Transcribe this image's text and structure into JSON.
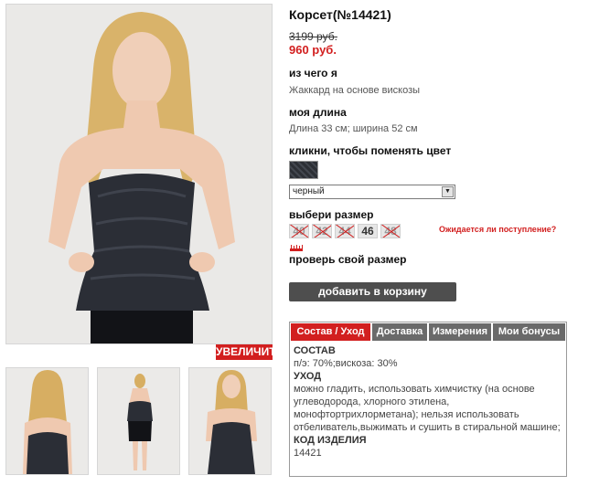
{
  "product": {
    "title": "Корсет(№14421)",
    "old_price": "3199 руб.",
    "new_price": "960 руб."
  },
  "material": {
    "label": "из чего я",
    "value": "Жаккард на основе вискозы"
  },
  "length": {
    "label": "моя длина",
    "value": "Длина 33 см; ширина 52 см"
  },
  "color": {
    "label": "кликни, чтобы поменять цвет",
    "selected": "черный"
  },
  "sizes": {
    "label": "выбери размер",
    "items": [
      {
        "label": "40",
        "available": false
      },
      {
        "label": "42",
        "available": false
      },
      {
        "label": "44",
        "available": false
      },
      {
        "label": "46",
        "available": true
      },
      {
        "label": "48",
        "available": false
      }
    ],
    "notify": "Ожидается ли поступление?",
    "check_size": "проверь свой размер"
  },
  "cart": {
    "label": "добавить в корзину"
  },
  "gallery": {
    "zoom_label": "УВЕЛИЧИТЬ"
  },
  "tabs": {
    "items": [
      {
        "label": "Состав / Уход",
        "active": true
      },
      {
        "label": "Доставка",
        "active": false
      },
      {
        "label": "Измерения",
        "active": false
      },
      {
        "label": "Мои бонусы",
        "active": false
      }
    ],
    "content": {
      "composition_heading": "СОСТАВ",
      "composition_text": "п/э: 70%;вискоза: 30%",
      "care_heading": "УХОД",
      "care_text": "можно гладить, использовать химчистку (на основе углеводорода, хлорного этилена, монофтортрихлорметана); нельзя использовать отбеливатель,выжимать и сушить в стиральной машине;",
      "code_heading": "КОД ИЗДЕЛИЯ",
      "code_value": "14421"
    }
  },
  "colors": {
    "accent": "#d21f1f",
    "button": "#4e4e4e",
    "tab_inactive": "#6a6a6a"
  }
}
